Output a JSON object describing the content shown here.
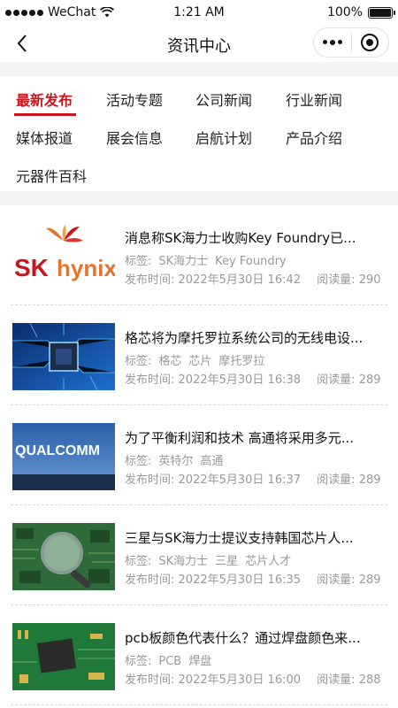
{
  "status_bar": {
    "carrier": "WeChat",
    "time": "1:21 AM",
    "battery": "100%",
    "battery_level": 1.0
  },
  "nav": {
    "title": "资讯中心",
    "back_icon": "chevron-left-icon",
    "more_icon": "more-dots-icon",
    "close_icon": "target-circle-icon"
  },
  "categories": [
    {
      "label": "最新发布",
      "active": true
    },
    {
      "label": "活动专题",
      "active": false
    },
    {
      "label": "公司新闻",
      "active": false
    },
    {
      "label": "行业新闻",
      "active": false
    },
    {
      "label": "媒体报道",
      "active": false
    },
    {
      "label": "展会信息",
      "active": false
    },
    {
      "label": "启航计划",
      "active": false
    },
    {
      "label": "产品介绍",
      "active": false
    },
    {
      "label": "元器件百科",
      "active": false
    }
  ],
  "colors": {
    "accent": "#c8161d"
  },
  "articles": [
    {
      "title": "消息称SK海力士收购Key Foundry已...",
      "tag_label": "标签:",
      "tags": [
        "SK海力士",
        "Key Foundry"
      ],
      "time_label": "发布时间:",
      "time": "2022年5月30日 16:42",
      "reads_label": "阅读量:",
      "reads": "290",
      "thumb_text_1": "SK",
      "thumb_text_2": "hynix"
    },
    {
      "title": "格芯将为摩托罗拉系统公司的无线电设...",
      "tag_label": "标签:",
      "tags": [
        "格芯",
        "芯片",
        "摩托罗拉"
      ],
      "time_label": "发布时间:",
      "time": "2022年5月30日 16:38",
      "reads_label": "阅读量:",
      "reads": "289"
    },
    {
      "title": "为了平衡利润和技术 高通将采用多元...",
      "tag_label": "标签:",
      "tags": [
        "英特尔",
        "高通"
      ],
      "time_label": "发布时间:",
      "time": "2022年5月30日 16:37",
      "reads_label": "阅读量:",
      "reads": "289",
      "thumb_text_1": "QUALCOMM"
    },
    {
      "title": "三星与SK海力士提议支持韩国芯片人...",
      "tag_label": "标签:",
      "tags": [
        "SK海力士",
        "三星",
        "芯片人才"
      ],
      "time_label": "发布时间:",
      "time": "2022年5月30日 16:35",
      "reads_label": "阅读量:",
      "reads": "289"
    },
    {
      "title": "pcb板颜色代表什么？通过焊盘颜色来...",
      "tag_label": "标签:",
      "tags": [
        "PCB",
        "焊盘"
      ],
      "time_label": "发布时间:",
      "time": "2022年5月30日 16:00",
      "reads_label": "阅读量:",
      "reads": "288"
    }
  ]
}
